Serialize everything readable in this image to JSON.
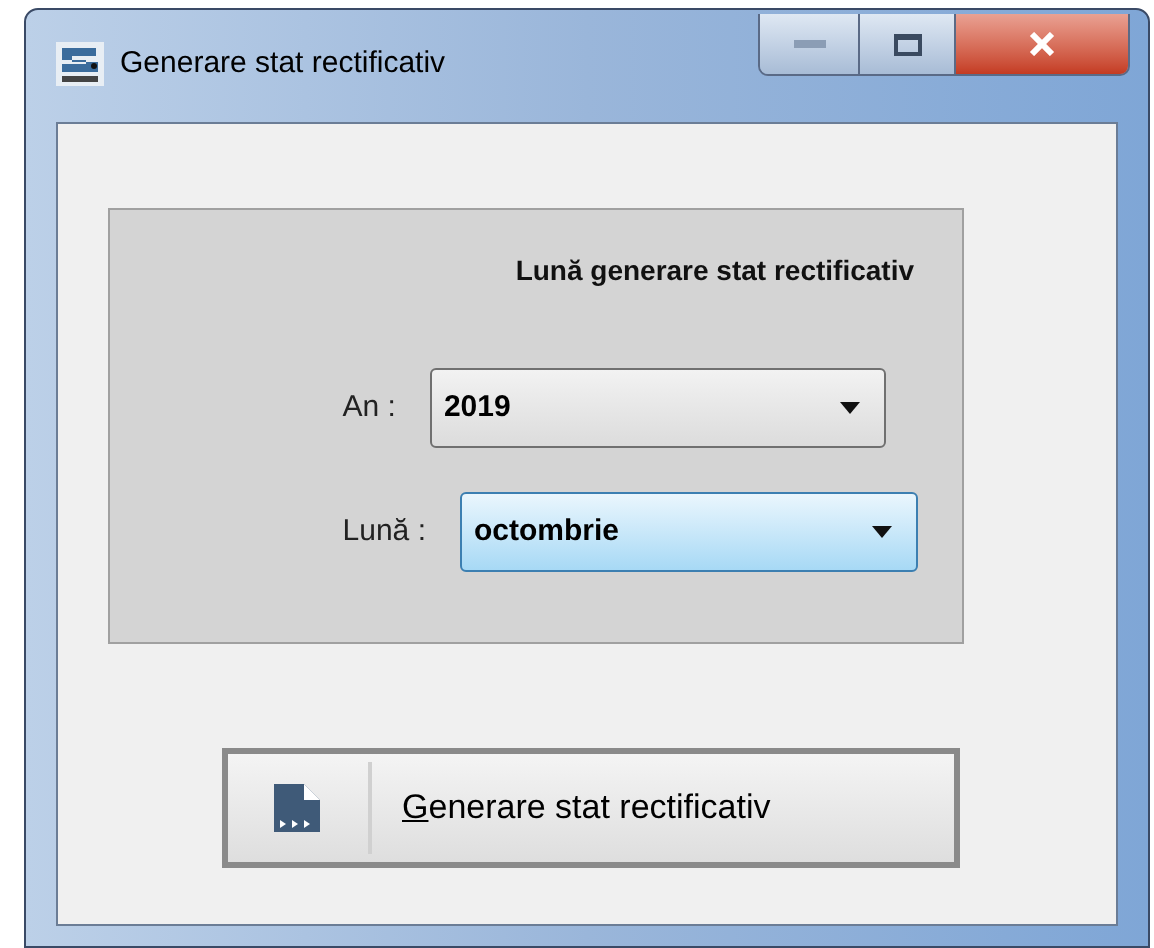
{
  "window": {
    "title": "Generare stat rectificativ"
  },
  "panel": {
    "title": "Lună generare stat rectificativ",
    "fields": [
      {
        "label": "An :",
        "value": "2019",
        "focused": false
      },
      {
        "label": "Lună :",
        "value": "octombrie",
        "focused": true
      }
    ]
  },
  "button": {
    "label": "Generare stat rectificativ"
  }
}
